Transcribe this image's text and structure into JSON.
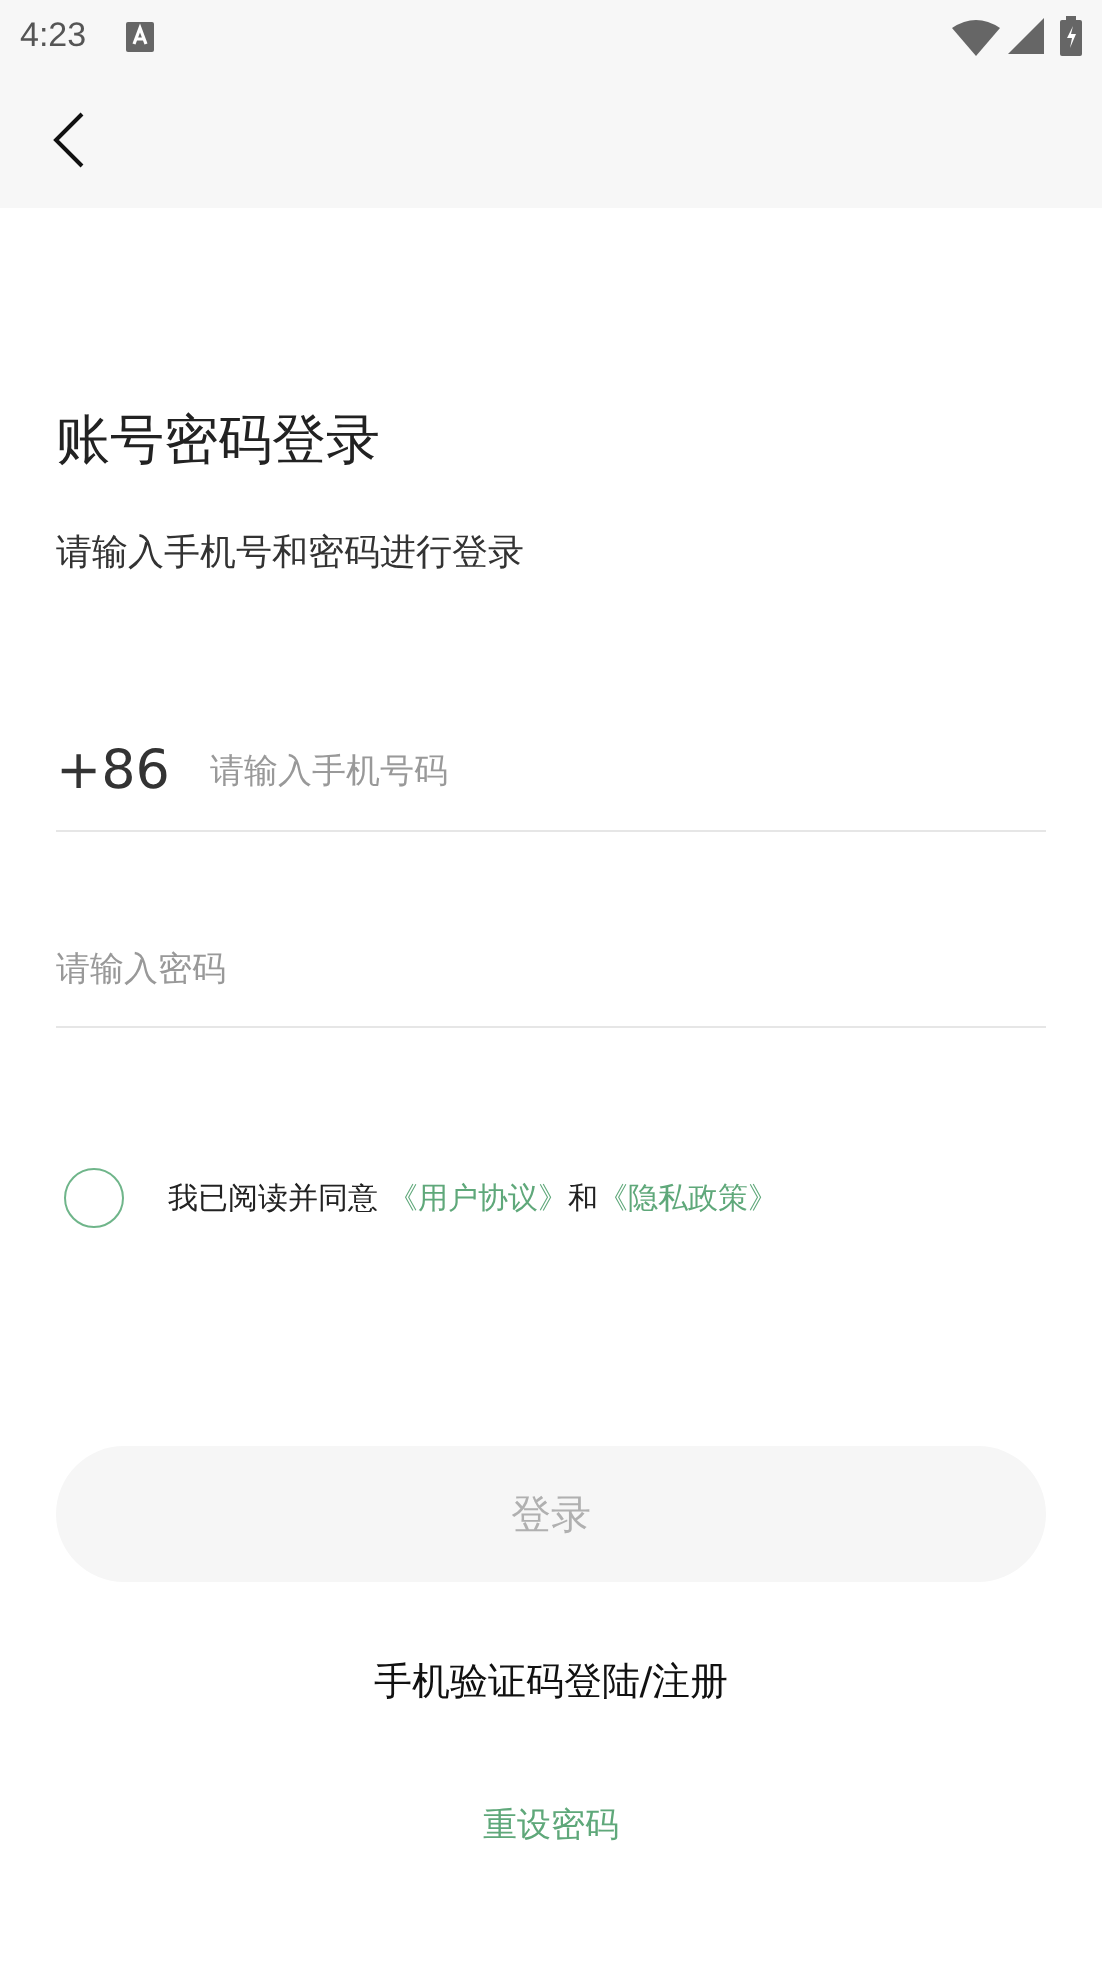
{
  "status_bar": {
    "time": "4:23"
  },
  "title": "账号密码登录",
  "subtitle": "请输入手机号和密码进行登录",
  "phone": {
    "prefix": "+86",
    "placeholder": "请输入手机号码"
  },
  "password": {
    "placeholder": "请输入密码"
  },
  "agreement": {
    "checked": false,
    "text": "我已阅读并同意 ",
    "links": [
      "《用户协议》",
      "《隐私政策》"
    ],
    "joiner": "和"
  },
  "login_button": {
    "label": "登录",
    "disabled": true
  },
  "sms_login": "手机验证码登陆/注册",
  "reset_password": "重设密码"
}
